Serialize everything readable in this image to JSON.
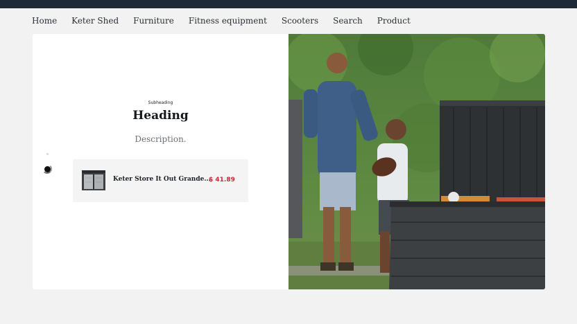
{
  "nav": {
    "items": [
      {
        "label": "Home"
      },
      {
        "label": "Keter Shed"
      },
      {
        "label": "Furniture"
      },
      {
        "label": "Fitness equipment"
      },
      {
        "label": "Scooters"
      },
      {
        "label": "Search"
      },
      {
        "label": "Product"
      }
    ]
  },
  "hero": {
    "subheading": "Subheading",
    "heading": "Heading",
    "description": "Description."
  },
  "product": {
    "name": "Keter Store It Out Grande...",
    "price": "$ 41.89",
    "thumbnail_icon": "storage-shed-icon"
  },
  "carousel": {
    "active_index": 1,
    "count": 2
  },
  "photo": {
    "icon": "family-garden-photo"
  },
  "colors": {
    "topbar": "#1e2a38",
    "price": "#c8283f",
    "background": "#f2f2f2"
  }
}
